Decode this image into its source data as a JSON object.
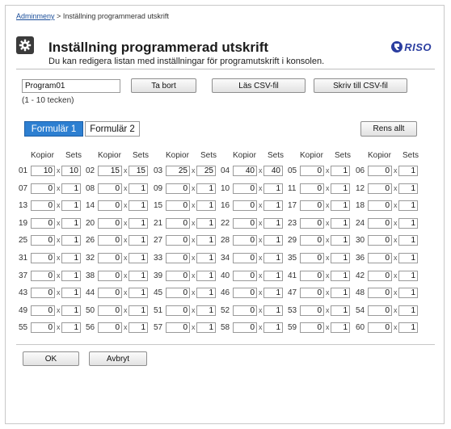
{
  "breadcrumb": {
    "root": "Adminmeny",
    "separator": ">",
    "current": "Inställning programmerad utskrift"
  },
  "header": {
    "title": "Inställning programmerad utskrift",
    "subtitle": "Du kan redigera listan med inställningar för programutskrift i konsolen.",
    "icon": "gear-icon",
    "logo_text": "RISO"
  },
  "program": {
    "name": "Program01",
    "hint": "(1 - 10 tecken)",
    "delete_label": "Ta bort",
    "read_csv_label": "Läs CSV-fil",
    "write_csv_label": "Skriv till CSV-fil"
  },
  "tabs": [
    {
      "label": "Formulär 1",
      "active": true
    },
    {
      "label": "Formulär 2",
      "active": false
    }
  ],
  "clear_all_label": "Rens allt",
  "grid": {
    "copies_header": "Kopior",
    "sets_header": "Sets",
    "times": "x",
    "rows": [
      [
        {
          "n": "01",
          "copies": "10",
          "sets": "10"
        },
        {
          "n": "02",
          "copies": "15",
          "sets": "15"
        },
        {
          "n": "03",
          "copies": "25",
          "sets": "25"
        },
        {
          "n": "04",
          "copies": "40",
          "sets": "40"
        },
        {
          "n": "05",
          "copies": "0",
          "sets": "1"
        },
        {
          "n": "06",
          "copies": "0",
          "sets": "1"
        }
      ],
      [
        {
          "n": "07",
          "copies": "0",
          "sets": "1"
        },
        {
          "n": "08",
          "copies": "0",
          "sets": "1"
        },
        {
          "n": "09",
          "copies": "0",
          "sets": "1"
        },
        {
          "n": "10",
          "copies": "0",
          "sets": "1"
        },
        {
          "n": "11",
          "copies": "0",
          "sets": "1"
        },
        {
          "n": "12",
          "copies": "0",
          "sets": "1"
        }
      ],
      [
        {
          "n": "13",
          "copies": "0",
          "sets": "1"
        },
        {
          "n": "14",
          "copies": "0",
          "sets": "1"
        },
        {
          "n": "15",
          "copies": "0",
          "sets": "1"
        },
        {
          "n": "16",
          "copies": "0",
          "sets": "1"
        },
        {
          "n": "17",
          "copies": "0",
          "sets": "1"
        },
        {
          "n": "18",
          "copies": "0",
          "sets": "1"
        }
      ],
      [
        {
          "n": "19",
          "copies": "0",
          "sets": "1"
        },
        {
          "n": "20",
          "copies": "0",
          "sets": "1"
        },
        {
          "n": "21",
          "copies": "0",
          "sets": "1"
        },
        {
          "n": "22",
          "copies": "0",
          "sets": "1"
        },
        {
          "n": "23",
          "copies": "0",
          "sets": "1"
        },
        {
          "n": "24",
          "copies": "0",
          "sets": "1"
        }
      ],
      [
        {
          "n": "25",
          "copies": "0",
          "sets": "1"
        },
        {
          "n": "26",
          "copies": "0",
          "sets": "1"
        },
        {
          "n": "27",
          "copies": "0",
          "sets": "1"
        },
        {
          "n": "28",
          "copies": "0",
          "sets": "1"
        },
        {
          "n": "29",
          "copies": "0",
          "sets": "1"
        },
        {
          "n": "30",
          "copies": "0",
          "sets": "1"
        }
      ],
      [
        {
          "n": "31",
          "copies": "0",
          "sets": "1"
        },
        {
          "n": "32",
          "copies": "0",
          "sets": "1"
        },
        {
          "n": "33",
          "copies": "0",
          "sets": "1"
        },
        {
          "n": "34",
          "copies": "0",
          "sets": "1"
        },
        {
          "n": "35",
          "copies": "0",
          "sets": "1"
        },
        {
          "n": "36",
          "copies": "0",
          "sets": "1"
        }
      ],
      [
        {
          "n": "37",
          "copies": "0",
          "sets": "1"
        },
        {
          "n": "38",
          "copies": "0",
          "sets": "1"
        },
        {
          "n": "39",
          "copies": "0",
          "sets": "1"
        },
        {
          "n": "40",
          "copies": "0",
          "sets": "1"
        },
        {
          "n": "41",
          "copies": "0",
          "sets": "1"
        },
        {
          "n": "42",
          "copies": "0",
          "sets": "1"
        }
      ],
      [
        {
          "n": "43",
          "copies": "0",
          "sets": "1"
        },
        {
          "n": "44",
          "copies": "0",
          "sets": "1"
        },
        {
          "n": "45",
          "copies": "0",
          "sets": "1"
        },
        {
          "n": "46",
          "copies": "0",
          "sets": "1"
        },
        {
          "n": "47",
          "copies": "0",
          "sets": "1"
        },
        {
          "n": "48",
          "copies": "0",
          "sets": "1"
        }
      ],
      [
        {
          "n": "49",
          "copies": "0",
          "sets": "1"
        },
        {
          "n": "50",
          "copies": "0",
          "sets": "1"
        },
        {
          "n": "51",
          "copies": "0",
          "sets": "1"
        },
        {
          "n": "52",
          "copies": "0",
          "sets": "1"
        },
        {
          "n": "53",
          "copies": "0",
          "sets": "1"
        },
        {
          "n": "54",
          "copies": "0",
          "sets": "1"
        }
      ],
      [
        {
          "n": "55",
          "copies": "0",
          "sets": "1"
        },
        {
          "n": "56",
          "copies": "0",
          "sets": "1"
        },
        {
          "n": "57",
          "copies": "0",
          "sets": "1"
        },
        {
          "n": "58",
          "copies": "0",
          "sets": "1"
        },
        {
          "n": "59",
          "copies": "0",
          "sets": "1"
        },
        {
          "n": "60",
          "copies": "0",
          "sets": "1"
        }
      ]
    ]
  },
  "footer": {
    "ok_label": "OK",
    "cancel_label": "Avbryt"
  },
  "colors": {
    "accent": "#2d7fd1",
    "logo": "#2b3ea0",
    "link": "#1a4d99"
  }
}
